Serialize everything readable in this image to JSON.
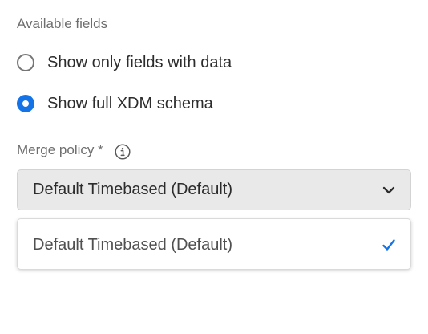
{
  "available_fields": {
    "label": "Available fields",
    "options": [
      {
        "label": "Show only fields with data",
        "selected": false
      },
      {
        "label": "Show full XDM schema",
        "selected": true
      }
    ]
  },
  "merge_policy": {
    "label": "Merge policy *",
    "info_icon": "info-icon",
    "selected_value": "Default Timebased (Default)",
    "chevron_icon": "chevron-down-icon",
    "menu": {
      "items": [
        {
          "label": "Default Timebased (Default)",
          "checked": true
        }
      ],
      "check_icon": "checkmark-icon"
    }
  },
  "colors": {
    "accent": "#1473e6",
    "picker_bg": "#e9e9e9",
    "label_gray": "#6e6e6e"
  }
}
